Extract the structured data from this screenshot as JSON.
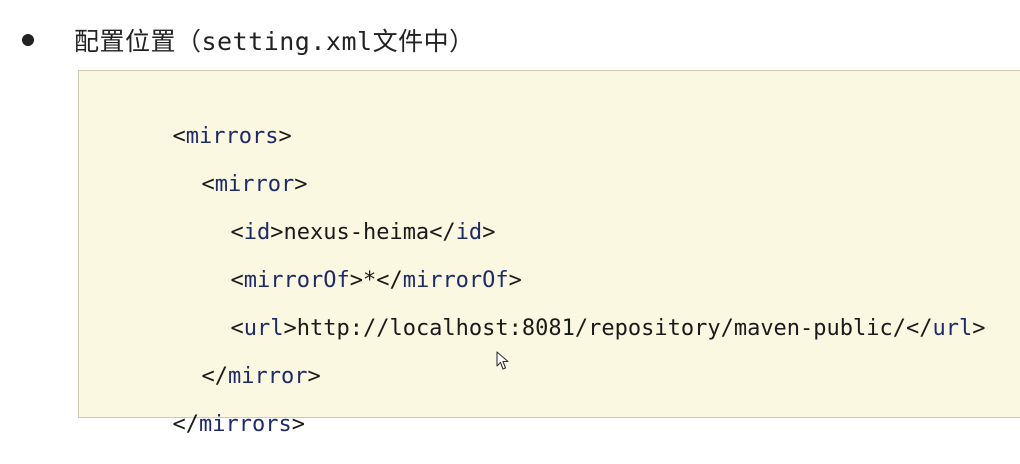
{
  "heading": {
    "bullet_text": "配置位置（setting.xml文件中）"
  },
  "code_block": {
    "lines": [
      {
        "open": "<",
        "tag": "mirrors",
        "close": ">",
        "text": "",
        "end_open": "",
        "end_tag": "",
        "end_close": ""
      },
      {
        "open": "<",
        "tag": "mirror",
        "close": ">",
        "text": "",
        "end_open": "",
        "end_tag": "",
        "end_close": ""
      },
      {
        "open": "<",
        "tag": "id",
        "close": ">",
        "text": "nexus-heima",
        "end_open": "</",
        "end_tag": "id",
        "end_close": ">"
      },
      {
        "open": "<",
        "tag": "mirrorOf",
        "close": ">",
        "text": "*",
        "end_open": "</",
        "end_tag": "mirrorOf",
        "end_close": ">"
      },
      {
        "open": "<",
        "tag": "url",
        "close": ">",
        "text": "http://localhost:8081/repository/maven-public/",
        "end_open": "</",
        "end_tag": "url",
        "end_close": ">"
      },
      {
        "open": "</",
        "tag": "mirror",
        "close": ">",
        "text": "",
        "end_open": "",
        "end_tag": "",
        "end_close": ""
      },
      {
        "open": "</",
        "tag": "mirrors",
        "close": ">",
        "text": "",
        "end_open": "",
        "end_tag": "",
        "end_close": ""
      }
    ]
  },
  "colors": {
    "tag": "#1f2a6b",
    "code_background": "#fbf8e1",
    "code_border": "#cfcab2"
  },
  "cursor": {
    "icon": "mouse-pointer-icon"
  }
}
